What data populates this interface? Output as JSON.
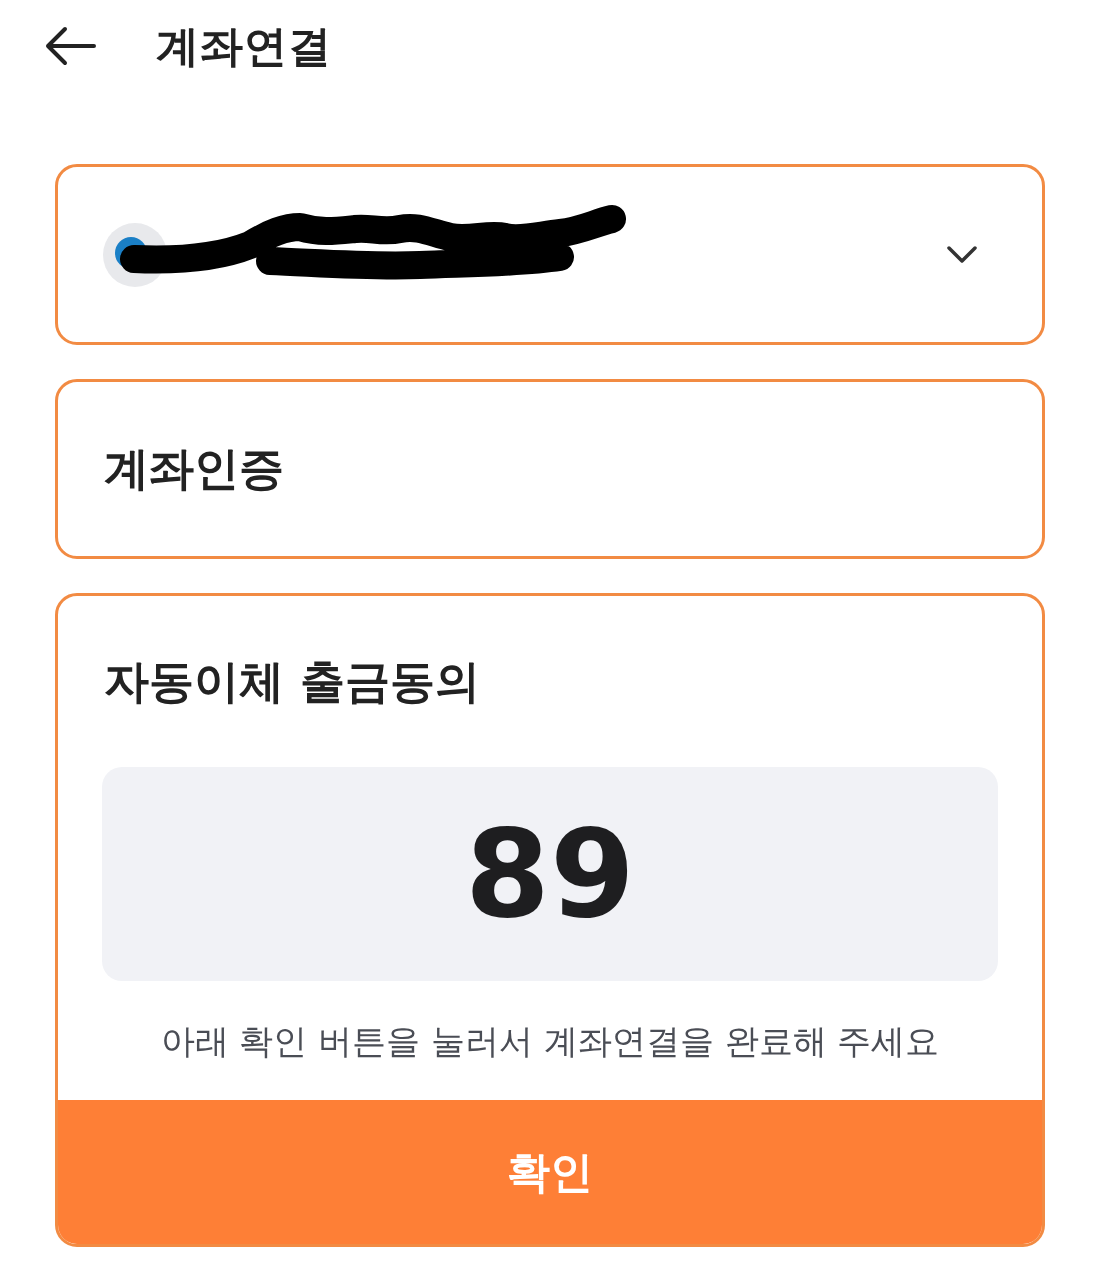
{
  "header": {
    "title": "계좌연결"
  },
  "account_select": {
    "redacted": true
  },
  "verification": {
    "title": "계좌인증"
  },
  "consent": {
    "title": "자동이체 출금동의",
    "code": "89",
    "instruction": "아래 확인 버튼을 눌러서 계좌연결을 완료해 주세요",
    "confirm_button": "확인"
  }
}
